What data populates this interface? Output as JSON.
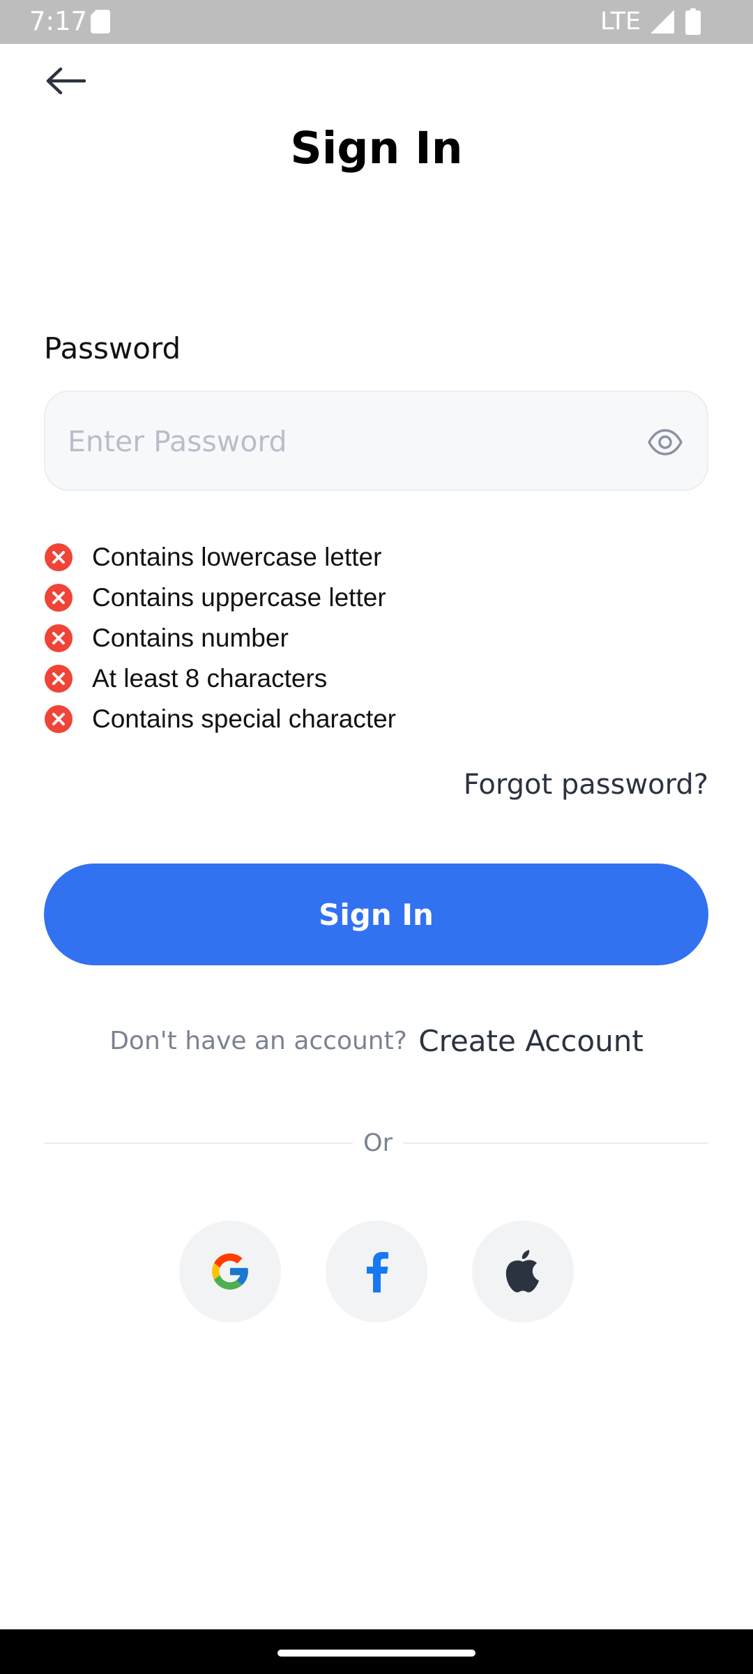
{
  "status_bar": {
    "time": "7:17",
    "network": "LTE"
  },
  "header": {
    "title": "Sign In"
  },
  "form": {
    "password_label": "Password",
    "password_value": "",
    "password_placeholder": "Enter Password",
    "rules": [
      {
        "text": "Contains lowercase letter",
        "met": false
      },
      {
        "text": "Contains uppercase letter",
        "met": false
      },
      {
        "text": "Contains number",
        "met": false
      },
      {
        "text": "At least 8 characters",
        "met": false
      },
      {
        "text": "Contains special character",
        "met": false
      }
    ],
    "forgot_label": "Forgot password?",
    "submit_label": "Sign In"
  },
  "signup": {
    "prompt": "Don't have an account?",
    "link": "Create Account"
  },
  "divider": {
    "text": "Or"
  },
  "social": [
    "google-icon",
    "facebook-icon",
    "apple-icon"
  ],
  "colors": {
    "accent": "#3272f0",
    "error": "#ef4437",
    "input_bg": "#f7f8fa",
    "social_bg": "#f2f3f5"
  }
}
